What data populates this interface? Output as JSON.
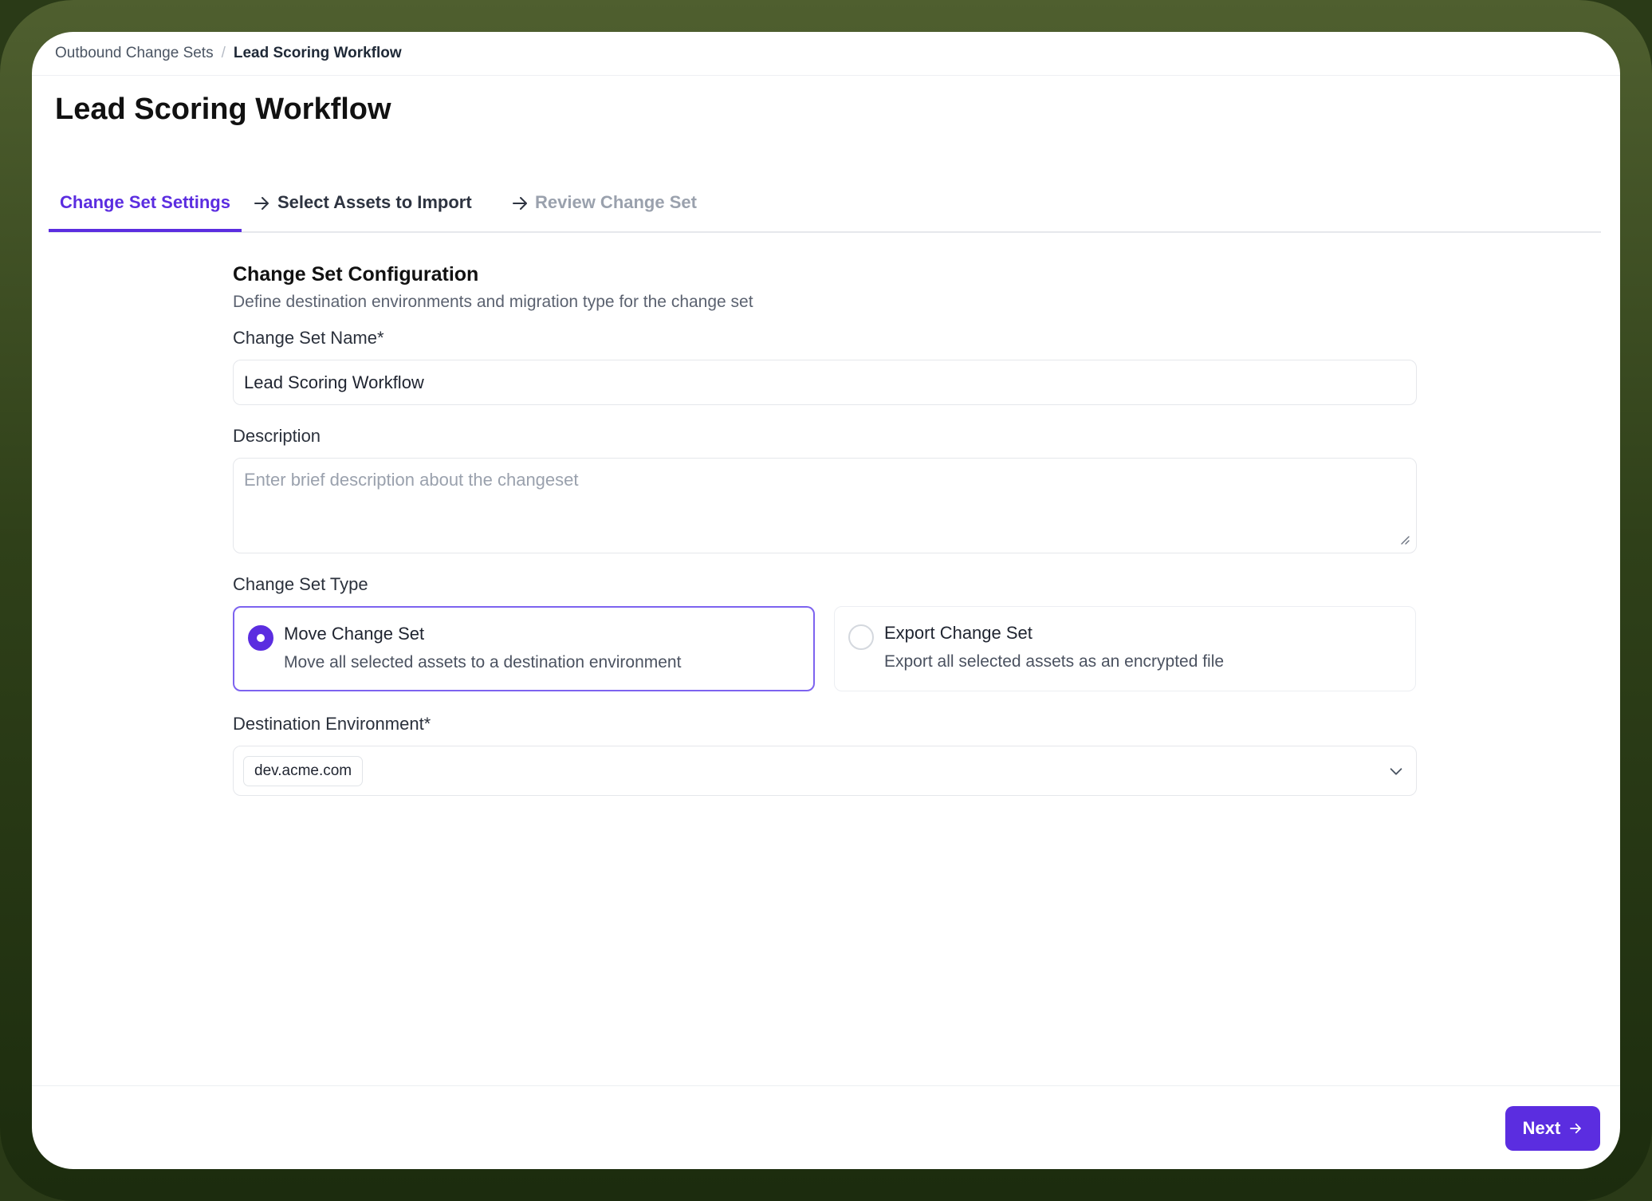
{
  "breadcrumb": {
    "parent": "Outbound Change Sets",
    "separator": "/",
    "current": "Lead Scoring Workflow"
  },
  "page_title": "Lead Scoring Workflow",
  "steps": [
    {
      "label": "Change Set Settings",
      "state": "active"
    },
    {
      "label": "Select Assets to Import",
      "state": "upcoming"
    },
    {
      "label": "Review Change Set",
      "state": "disabled"
    }
  ],
  "section": {
    "title": "Change Set Configuration",
    "description": "Define destination environments and migration type for the change set"
  },
  "fields": {
    "name": {
      "label": "Change Set Name*",
      "value": "Lead Scoring Workflow"
    },
    "description": {
      "label": "Description",
      "value": "",
      "placeholder": "Enter brief description about the changeset"
    },
    "type": {
      "label": "Change Set Type",
      "options": [
        {
          "title": "Move Change Set",
          "description": "Move all selected assets to a destination environment",
          "selected": true
        },
        {
          "title": "Export Change Set",
          "description": "Export all selected assets as an encrypted file",
          "selected": false
        }
      ]
    },
    "destination": {
      "label": "Destination Environment*",
      "selected_chip": "dev.acme.com"
    }
  },
  "footer": {
    "next_label": "Next"
  },
  "colors": {
    "accent": "#5b2de0",
    "selected_border": "#7d63ef",
    "background_frame": "#2f4019"
  },
  "icons": {
    "step_separator": "arrow-right-icon",
    "select_toggle": "chevron-down-icon",
    "next": "arrow-right-icon",
    "textarea_resize": "resize-handle-icon"
  }
}
